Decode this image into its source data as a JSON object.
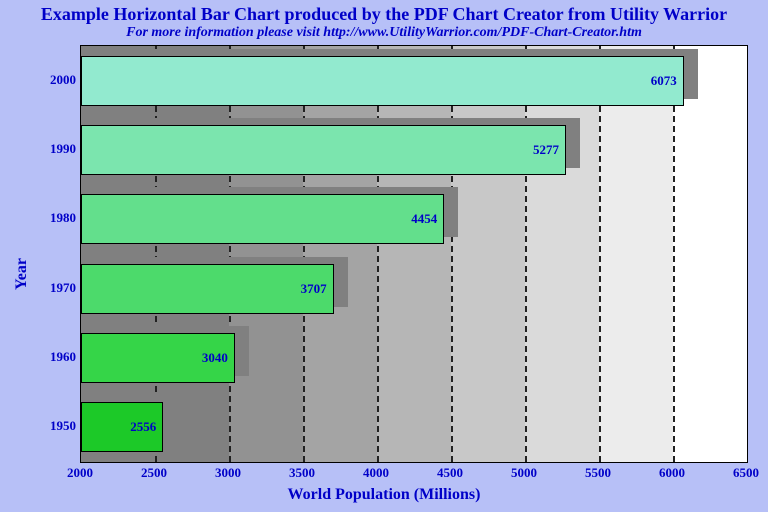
{
  "title": "Example Horizontal Bar Chart produced by the PDF Chart Creator from Utility Warrior",
  "subtitle": "For more information please visit http://www.UtilityWarrior.com/PDF-Chart-Creator.htm",
  "xlabel": "World Population (Millions)",
  "ylabel": "Year",
  "chart_data": {
    "type": "bar",
    "orientation": "horizontal",
    "categories": [
      "1950",
      "1960",
      "1970",
      "1980",
      "1990",
      "2000"
    ],
    "values": [
      2556,
      3040,
      3707,
      4454,
      5277,
      6073
    ],
    "bar_colors": [
      "#1cc928",
      "#35d548",
      "#4cda6b",
      "#63df8c",
      "#7be5ae",
      "#92eacf"
    ],
    "xlim": [
      2000,
      6500
    ],
    "xticks": [
      2000,
      2500,
      3000,
      3500,
      4000,
      4500,
      5000,
      5500,
      6000,
      6500
    ],
    "bg_bands": [
      {
        "from": 2000,
        "to": 3000,
        "color": "#808080"
      },
      {
        "from": 3000,
        "to": 3500,
        "color": "#929292"
      },
      {
        "from": 3500,
        "to": 4000,
        "color": "#a4a4a4"
      },
      {
        "from": 4000,
        "to": 4500,
        "color": "#b6b6b6"
      },
      {
        "from": 4500,
        "to": 5000,
        "color": "#c8c8c8"
      },
      {
        "from": 5000,
        "to": 5500,
        "color": "#dadada"
      },
      {
        "from": 5500,
        "to": 6000,
        "color": "#ececec"
      },
      {
        "from": 6000,
        "to": 6500,
        "color": "#ffffff"
      }
    ],
    "gridlines": [
      2500,
      3000,
      3500,
      4000,
      4500,
      5000,
      5500,
      6000
    ]
  }
}
